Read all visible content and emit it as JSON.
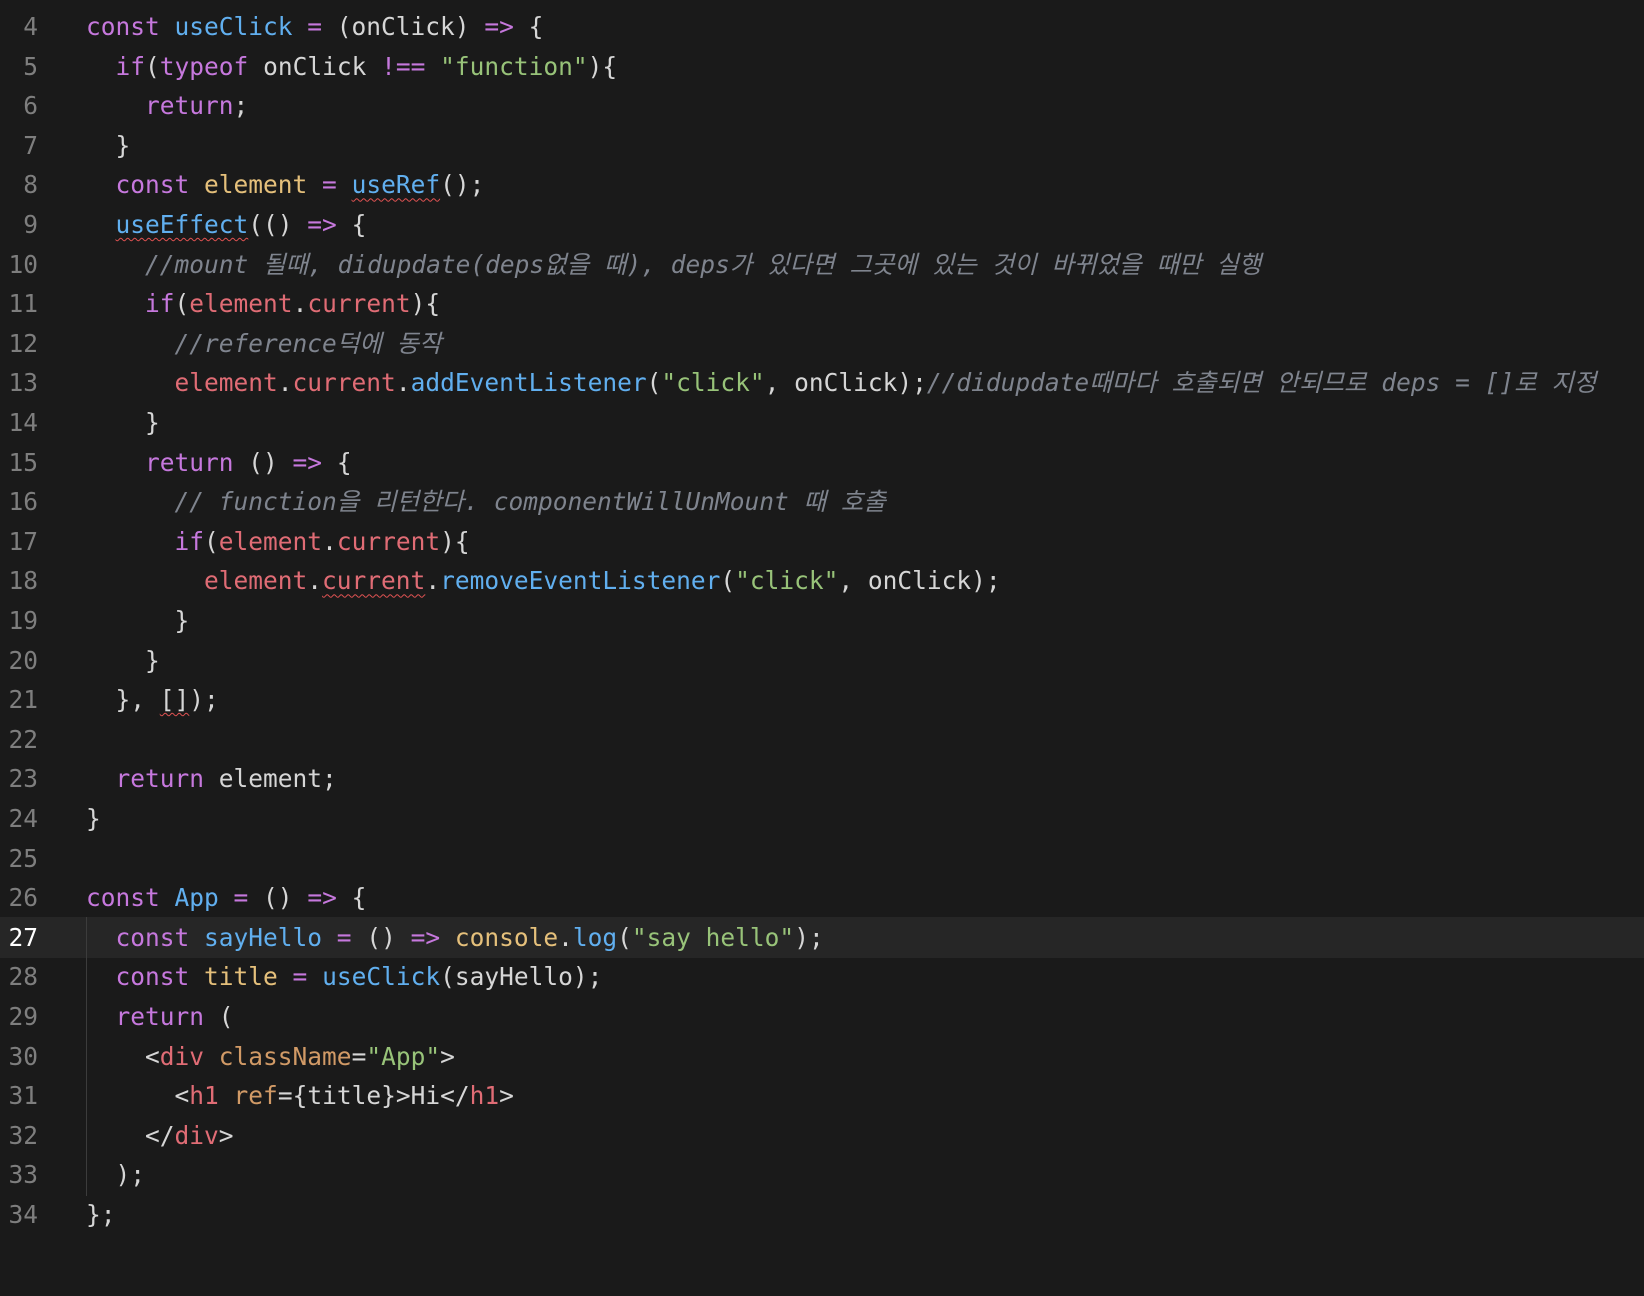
{
  "editor": {
    "current_line": 27,
    "lines": [
      {
        "n": 4,
        "tokens": [
          [
            "kw",
            "const "
          ],
          [
            "fn",
            "useClick"
          ],
          [
            "op",
            " = "
          ],
          [
            "pl",
            "(onClick) "
          ],
          [
            "op",
            "=>"
          ],
          [
            "pl",
            " {"
          ]
        ]
      },
      {
        "n": 5,
        "tokens": [
          [
            "pl",
            "  "
          ],
          [
            "kw",
            "if"
          ],
          [
            "pl",
            "("
          ],
          [
            "kw",
            "typeof"
          ],
          [
            "pl",
            " onClick "
          ],
          [
            "op",
            "!=="
          ],
          [
            "pl",
            " "
          ],
          [
            "str",
            "\"function\""
          ],
          [
            "pl",
            "){"
          ]
        ]
      },
      {
        "n": 6,
        "tokens": [
          [
            "pl",
            "    "
          ],
          [
            "kw",
            "return"
          ],
          [
            "pl",
            ";"
          ]
        ]
      },
      {
        "n": 7,
        "tokens": [
          [
            "pl",
            "  }"
          ]
        ]
      },
      {
        "n": 8,
        "tokens": [
          [
            "pl",
            "  "
          ],
          [
            "kw",
            "const "
          ],
          [
            "var",
            "element"
          ],
          [
            "op",
            " = "
          ],
          [
            "fn squig",
            "useRef"
          ],
          [
            "pl",
            "();"
          ]
        ]
      },
      {
        "n": 9,
        "tokens": [
          [
            "pl",
            "  "
          ],
          [
            "fn squig",
            "useEffect"
          ],
          [
            "pl",
            "(() "
          ],
          [
            "op",
            "=>"
          ],
          [
            "pl",
            " {"
          ]
        ]
      },
      {
        "n": 10,
        "tokens": [
          [
            "pl",
            "    "
          ],
          [
            "cmt",
            "//mount 될때, didupdate(deps없을 때), deps가 있다면 그곳에 있는 것이 바뀌었을 때만 실행"
          ]
        ]
      },
      {
        "n": 11,
        "tokens": [
          [
            "pl",
            "    "
          ],
          [
            "kw",
            "if"
          ],
          [
            "pl",
            "("
          ],
          [
            "prop",
            "element"
          ],
          [
            "pl",
            "."
          ],
          [
            "prop",
            "current"
          ],
          [
            "pl",
            "){"
          ]
        ]
      },
      {
        "n": 12,
        "tokens": [
          [
            "pl",
            "      "
          ],
          [
            "cmt",
            "//reference덕에 동작"
          ]
        ]
      },
      {
        "n": 13,
        "tokens": [
          [
            "pl",
            "      "
          ],
          [
            "prop",
            "element"
          ],
          [
            "pl",
            "."
          ],
          [
            "prop",
            "current"
          ],
          [
            "pl",
            "."
          ],
          [
            "fn",
            "addEventListener"
          ],
          [
            "pl",
            "("
          ],
          [
            "str",
            "\"click\""
          ],
          [
            "pl",
            ", onClick);"
          ],
          [
            "cmt",
            "//didupdate때마다 호출되면 안되므로 deps = []로 지정"
          ]
        ]
      },
      {
        "n": 14,
        "tokens": [
          [
            "pl",
            "    }"
          ]
        ]
      },
      {
        "n": 15,
        "tokens": [
          [
            "pl",
            "    "
          ],
          [
            "kw",
            "return"
          ],
          [
            "pl",
            " () "
          ],
          [
            "op",
            "=>"
          ],
          [
            "pl",
            " {"
          ]
        ]
      },
      {
        "n": 16,
        "tokens": [
          [
            "pl",
            "      "
          ],
          [
            "cmt",
            "// function을 리턴한다. componentWillUnMount 때 호출"
          ]
        ]
      },
      {
        "n": 17,
        "tokens": [
          [
            "pl",
            "      "
          ],
          [
            "kw",
            "if"
          ],
          [
            "pl",
            "("
          ],
          [
            "prop",
            "element"
          ],
          [
            "pl",
            "."
          ],
          [
            "prop",
            "current"
          ],
          [
            "pl",
            "){"
          ]
        ]
      },
      {
        "n": 18,
        "tokens": [
          [
            "pl",
            "        "
          ],
          [
            "prop",
            "element"
          ],
          [
            "pl",
            "."
          ],
          [
            "prop squig",
            "current"
          ],
          [
            "pl",
            "."
          ],
          [
            "fn",
            "removeEventListener"
          ],
          [
            "pl",
            "("
          ],
          [
            "str",
            "\"click\""
          ],
          [
            "pl",
            ", onClick);"
          ]
        ]
      },
      {
        "n": 19,
        "tokens": [
          [
            "pl",
            "      }"
          ]
        ]
      },
      {
        "n": 20,
        "tokens": [
          [
            "pl",
            "    }"
          ]
        ]
      },
      {
        "n": 21,
        "tokens": [
          [
            "pl",
            "  }, "
          ],
          [
            "pl squig",
            "[]"
          ],
          [
            "pl",
            ");"
          ]
        ]
      },
      {
        "n": 22,
        "tokens": []
      },
      {
        "n": 23,
        "tokens": [
          [
            "pl",
            "  "
          ],
          [
            "kw",
            "return"
          ],
          [
            "pl",
            " element;"
          ]
        ]
      },
      {
        "n": 24,
        "tokens": [
          [
            "pl",
            "}"
          ]
        ]
      },
      {
        "n": 25,
        "tokens": []
      },
      {
        "n": 26,
        "tokens": [
          [
            "kw",
            "const "
          ],
          [
            "fn",
            "App"
          ],
          [
            "op",
            " = "
          ],
          [
            "pl",
            "() "
          ],
          [
            "op",
            "=>"
          ],
          [
            "pl",
            " {"
          ]
        ]
      },
      {
        "n": 27,
        "tokens": [
          [
            "pl",
            "  "
          ],
          [
            "kw",
            "const "
          ],
          [
            "fn",
            "sayHello"
          ],
          [
            "op",
            " = "
          ],
          [
            "pl",
            "() "
          ],
          [
            "op",
            "=>"
          ],
          [
            "pl",
            " "
          ],
          [
            "obj",
            "console"
          ],
          [
            "pl",
            "."
          ],
          [
            "fn",
            "log"
          ],
          [
            "pl",
            "("
          ],
          [
            "str",
            "\"say hello\""
          ],
          [
            "pl",
            ");"
          ]
        ]
      },
      {
        "n": 28,
        "tokens": [
          [
            "pl",
            "  "
          ],
          [
            "kw",
            "const "
          ],
          [
            "var",
            "title"
          ],
          [
            "op",
            " = "
          ],
          [
            "fn",
            "useClick"
          ],
          [
            "pl",
            "(sayHello);"
          ]
        ]
      },
      {
        "n": 29,
        "tokens": [
          [
            "pl",
            "  "
          ],
          [
            "kw",
            "return"
          ],
          [
            "pl",
            " ("
          ]
        ]
      },
      {
        "n": 30,
        "tokens": [
          [
            "pl",
            "    <"
          ],
          [
            "tag",
            "div"
          ],
          [
            "pl",
            " "
          ],
          [
            "attr",
            "className"
          ],
          [
            "pl",
            "="
          ],
          [
            "str",
            "\"App\""
          ],
          [
            "pl",
            ">"
          ]
        ]
      },
      {
        "n": 31,
        "tokens": [
          [
            "pl",
            "      <"
          ],
          [
            "tag",
            "h1"
          ],
          [
            "pl",
            " "
          ],
          [
            "attr",
            "ref"
          ],
          [
            "pl",
            "={title}>Hi</"
          ],
          [
            "tag",
            "h1"
          ],
          [
            "pl",
            ">"
          ]
        ]
      },
      {
        "n": 32,
        "tokens": [
          [
            "pl",
            "    </"
          ],
          [
            "tag",
            "div"
          ],
          [
            "pl",
            ">"
          ]
        ]
      },
      {
        "n": 33,
        "tokens": [
          [
            "pl",
            "  );"
          ]
        ]
      },
      {
        "n": 34,
        "tokens": [
          [
            "pl",
            "};"
          ]
        ]
      }
    ]
  }
}
